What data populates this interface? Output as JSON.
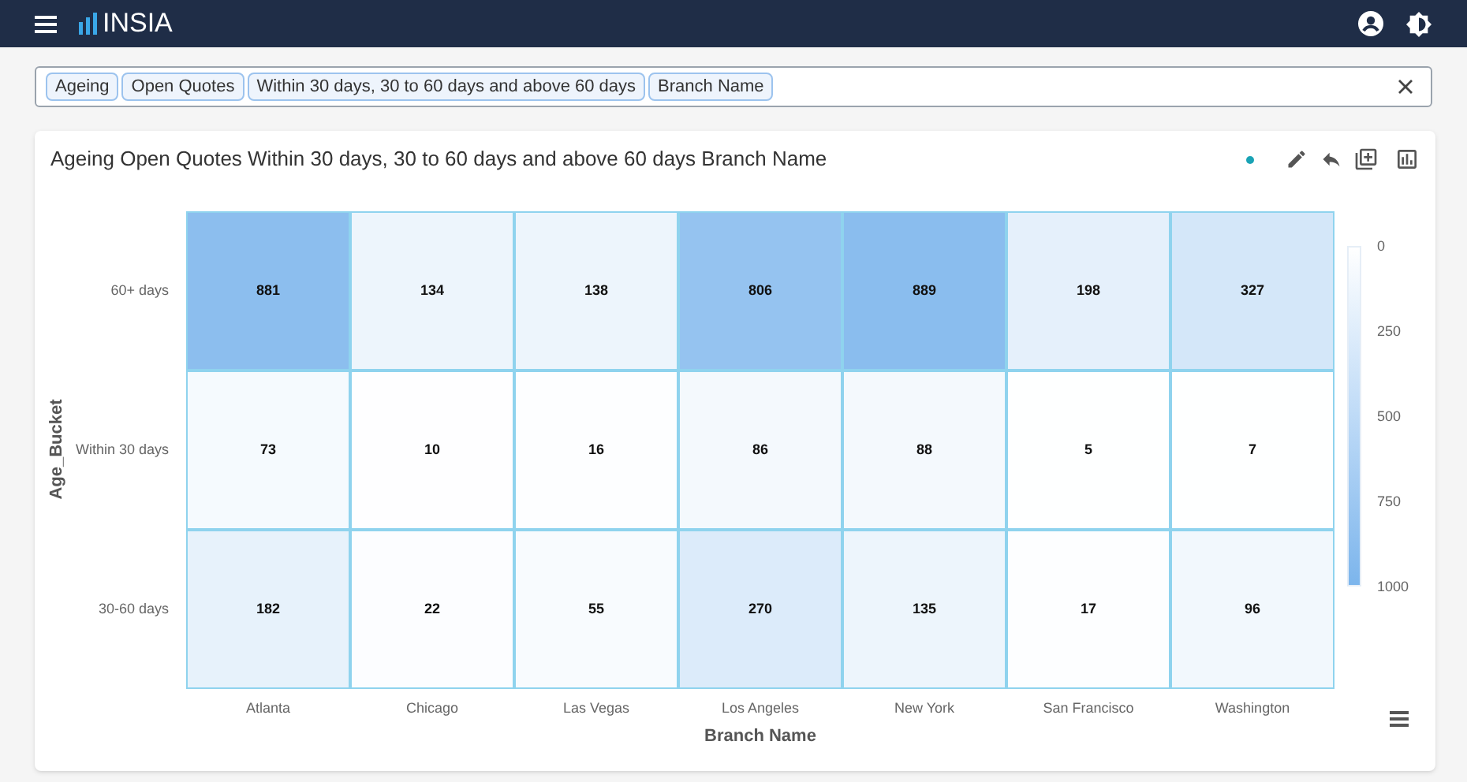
{
  "app": {
    "title": "INSIA"
  },
  "filter": {
    "tokens": [
      "Ageing",
      "Open Quotes",
      "Within 30 days, 30 to 60 days and above 60 days",
      "Branch Name"
    ]
  },
  "card": {
    "title": "Ageing Open Quotes Within 30 days, 30 to 60 days and above 60 days Branch Name",
    "heatmap": {
      "y_axis_title": "Age_Bucket",
      "row_labels": [
        "60+ days",
        "Within 30 days",
        "30-60 days"
      ],
      "cells": [
        [
          {
            "value": "881",
            "color": "#8cbeee"
          },
          {
            "value": "134",
            "color": "#edf5fc"
          },
          {
            "value": "138",
            "color": "#edf5fc"
          },
          {
            "value": "806",
            "color": "#95c3f0"
          },
          {
            "value": "889",
            "color": "#8abdee"
          },
          {
            "value": "198",
            "color": "#e5f0fb"
          },
          {
            "value": "327",
            "color": "#d4e7f9"
          }
        ],
        [
          {
            "value": "73",
            "color": "#f5fafe"
          },
          {
            "value": "10",
            "color": "#fefeff"
          },
          {
            "value": "16",
            "color": "#fdfeff"
          },
          {
            "value": "86",
            "color": "#f4f9fd"
          },
          {
            "value": "88",
            "color": "#f4f9fd"
          },
          {
            "value": "5",
            "color": "#feffff"
          },
          {
            "value": "7",
            "color": "#feffff"
          }
        ],
        [
          {
            "value": "182",
            "color": "#e7f2fb"
          },
          {
            "value": "22",
            "color": "#fcfdff"
          },
          {
            "value": "55",
            "color": "#f8fbfe"
          },
          {
            "value": "270",
            "color": "#dcebfa"
          },
          {
            "value": "135",
            "color": "#edf5fc"
          },
          {
            "value": "17",
            "color": "#fdfeff"
          },
          {
            "value": "96",
            "color": "#f2f8fd"
          }
        ]
      ],
      "column_labels": [
        "Atlanta",
        "Chicago",
        "Las Vegas",
        "Los Angeles",
        "New York",
        "San Francisco",
        "Washington"
      ],
      "x_axis_title": "Branch Name",
      "legend_labels": [
        "0",
        "250",
        "500",
        "750",
        "1000"
      ]
    }
  }
}
